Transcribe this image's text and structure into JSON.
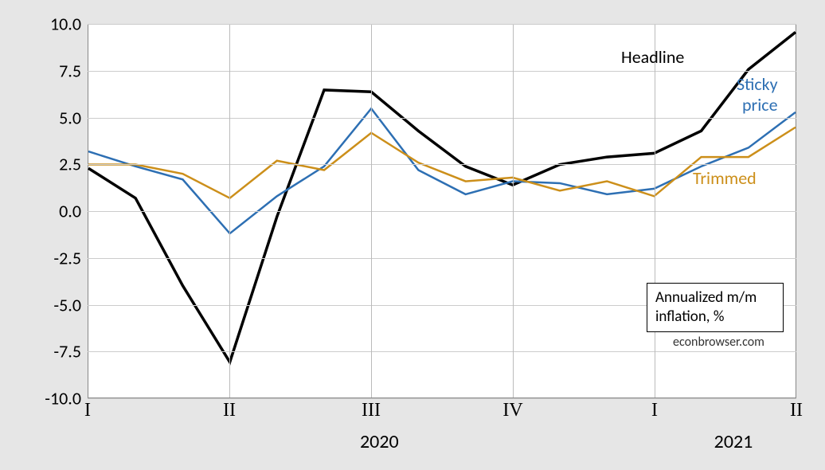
{
  "chart_data": {
    "type": "line",
    "title": "",
    "xlabel": "",
    "ylabel": "",
    "ylim": [
      -10,
      10
    ],
    "y_ticks": [
      -10.0,
      -7.5,
      -5.0,
      -2.5,
      0.0,
      2.5,
      5.0,
      7.5,
      10.0
    ],
    "x_quarter_ticks": [
      "I",
      "II",
      "III",
      "IV",
      "I",
      "II"
    ],
    "x_year_labels": [
      "2020",
      "2021"
    ],
    "categories": [
      "2020-01",
      "2020-02",
      "2020-03",
      "2020-04",
      "2020-05",
      "2020-06",
      "2020-07",
      "2020-08",
      "2020-09",
      "2020-10",
      "2020-11",
      "2020-12",
      "2021-01",
      "2021-02",
      "2021-03",
      "2021-04"
    ],
    "series": [
      {
        "name": "Headline",
        "color": "#000000",
        "values": [
          2.3,
          0.7,
          -4.0,
          -8.1,
          -0.3,
          6.5,
          6.4,
          4.3,
          2.4,
          1.4,
          2.5,
          2.9,
          3.1,
          4.3,
          7.6,
          9.6
        ]
      },
      {
        "name": "Sticky price",
        "color": "#2d6fb3",
        "values": [
          3.2,
          2.4,
          1.7,
          -1.2,
          0.8,
          2.4,
          5.5,
          2.2,
          0.9,
          1.6,
          1.5,
          0.9,
          1.2,
          2.4,
          3.4,
          5.3
        ]
      },
      {
        "name": "Trimmed",
        "color": "#cc8f1a",
        "values": [
          2.5,
          2.5,
          2.0,
          0.7,
          2.7,
          2.2,
          4.2,
          2.6,
          1.6,
          1.8,
          1.1,
          1.6,
          0.8,
          2.9,
          2.9,
          4.5
        ]
      }
    ],
    "legend_box": {
      "line1": "Annualized m/m",
      "line2": "inflation, %"
    },
    "credit": "econbrowser.com"
  },
  "series_labels": {
    "headline": "Headline",
    "sticky1": "Sticky",
    "sticky2": "price",
    "trimmed": "Trimmed"
  }
}
